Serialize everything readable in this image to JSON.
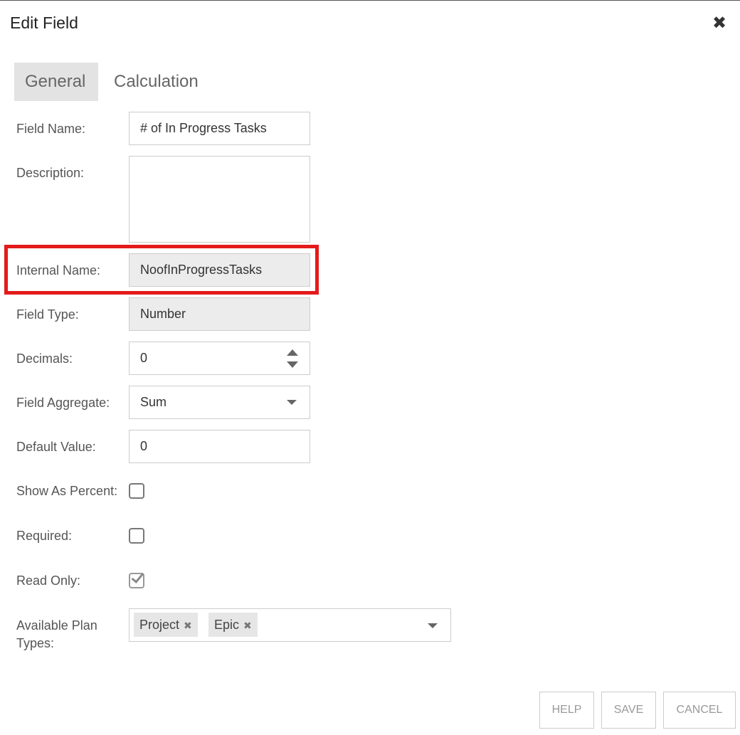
{
  "dialog": {
    "title": "Edit Field",
    "close_icon": "✖"
  },
  "tabs": [
    {
      "label": "General",
      "active": true
    },
    {
      "label": "Calculation",
      "active": false
    }
  ],
  "form": {
    "field_name": {
      "label": "Field Name:",
      "value": "# of In Progress Tasks"
    },
    "description": {
      "label": "Description:",
      "value": ""
    },
    "internal_name": {
      "label": "Internal Name:",
      "value": "NoofInProgressTasks"
    },
    "field_type": {
      "label": "Field Type:",
      "value": "Number"
    },
    "decimals": {
      "label": "Decimals:",
      "value": "0"
    },
    "field_aggregate": {
      "label": "Field Aggregate:",
      "value": "Sum"
    },
    "default_value": {
      "label": "Default Value:",
      "value": "0"
    },
    "show_as_percent": {
      "label": "Show As Percent:",
      "checked": false
    },
    "required": {
      "label": "Required:",
      "checked": false
    },
    "read_only": {
      "label": "Read Only:",
      "checked": true
    },
    "plan_types": {
      "label_line1": "Available Plan",
      "label_line2": "Types:",
      "tags": [
        "Project",
        "Epic"
      ],
      "remove_icon": "✖"
    }
  },
  "footer": {
    "help": "HELP",
    "save": "SAVE",
    "cancel": "CANCEL"
  },
  "colors": {
    "highlight": "#e31b1b",
    "readonly_bg": "#ececec",
    "active_tab_bg": "#e3e3e3"
  }
}
